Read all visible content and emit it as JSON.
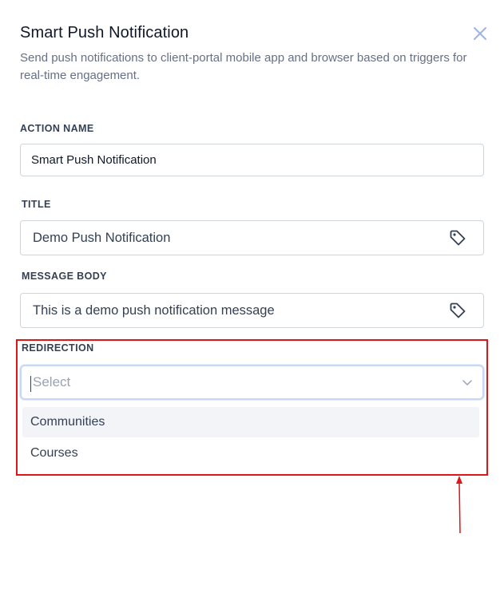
{
  "header": {
    "title": "Smart Push Notification",
    "description": "Send push notifications to client-portal mobile app and browser based on triggers for real-time engagement.",
    "close_icon": "close-icon"
  },
  "fields": {
    "action_name": {
      "label": "ACTION NAME",
      "value": "Smart Push Notification"
    },
    "title": {
      "label": "TITLE",
      "value": "Demo Push Notification",
      "icon": "tag-icon"
    },
    "message_body": {
      "label": "MESSAGE BODY",
      "value": "This is a demo push notification message",
      "icon": "tag-icon"
    },
    "redirection": {
      "label": "REDIRECTION",
      "placeholder": "Select",
      "icon": "chevron-down-icon",
      "options": [
        {
          "label": "Communities",
          "highlighted": true
        },
        {
          "label": "Courses",
          "highlighted": false
        }
      ]
    }
  },
  "annotation": {
    "highlight_color": "#e01515",
    "arrow_color": "#e01515"
  }
}
